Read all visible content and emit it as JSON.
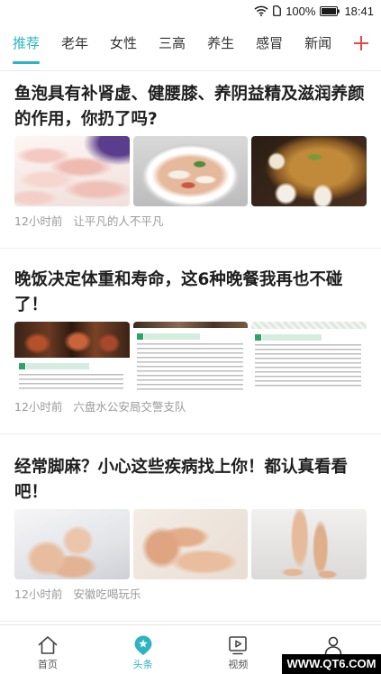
{
  "status_bar": {
    "icons": [
      "wifi-icon",
      "sim-card-icon",
      "battery-icon"
    ],
    "battery_percent": "100%",
    "time": "18:41"
  },
  "colors": {
    "accent": "#2db4c3",
    "add_button": "#e8484a"
  },
  "channel_tabs": {
    "tabs": [
      {
        "label": "推荐",
        "active": true
      },
      {
        "label": "老年",
        "active": false
      },
      {
        "label": "女性",
        "active": false
      },
      {
        "label": "三高",
        "active": false
      },
      {
        "label": "养生",
        "active": false
      },
      {
        "label": "感冒",
        "active": false
      },
      {
        "label": "新闻",
        "active": false
      }
    ],
    "add_icon": "plus-icon"
  },
  "articles": [
    {
      "title": "鱼泡具有补肾虚、健腰膝、养阴益精及滋润养颜的作用，你扔了吗?",
      "time": "12小时前",
      "source": "让平凡的人不平凡"
    },
    {
      "title": "晚饭决定体重和寿命，这6种晚餐我再也不碰了！",
      "time": "12小时前",
      "source": "六盘水公安局交警支队"
    },
    {
      "title": "经常脚麻？小心这些疾病找上你！都认真看看吧！",
      "time": "12小时前",
      "source": "安徽吃喝玩乐"
    }
  ],
  "bottom_nav": {
    "items": [
      {
        "label": "首页",
        "icon": "home-icon",
        "active": false
      },
      {
        "label": "头条",
        "icon": "star-badge-icon",
        "active": true
      },
      {
        "label": "视频",
        "icon": "video-icon",
        "active": false
      },
      {
        "icon": "user-icon",
        "active": false
      }
    ]
  },
  "watermark": "WWW.QT6.COM"
}
